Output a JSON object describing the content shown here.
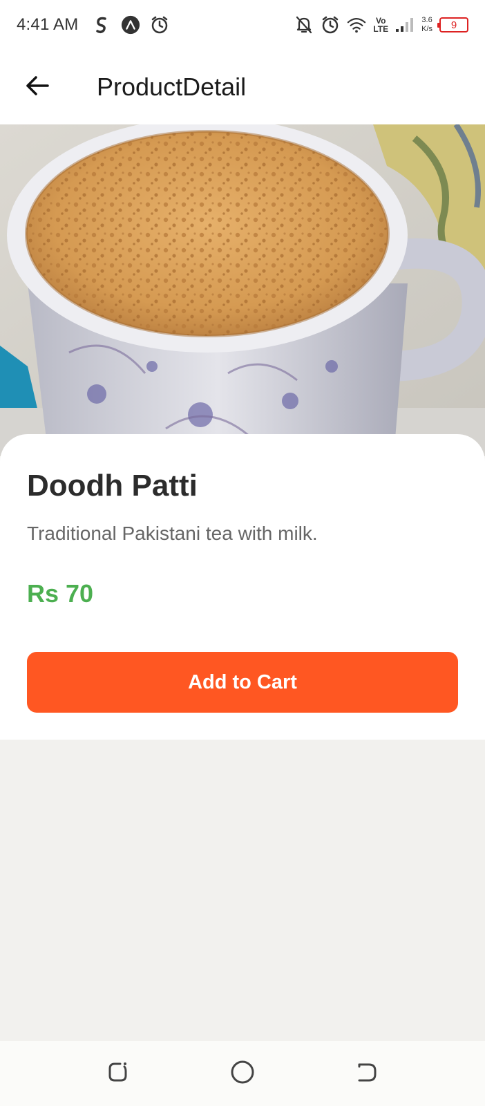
{
  "status_bar": {
    "time": "4:41 AM",
    "network_top": "Vo",
    "network_bottom": "LTE",
    "speed_value": "3.6",
    "speed_unit": "K/s",
    "battery_level": "9"
  },
  "header": {
    "title": "ProductDetail"
  },
  "product": {
    "name": "Doodh Patti",
    "description": "Traditional Pakistani tea with milk.",
    "price": "Rs 70",
    "add_button_label": "Add to Cart"
  },
  "colors": {
    "accent": "#ff5722",
    "price": "#4caf50",
    "battery_low": "#dd2222"
  },
  "icons": {
    "back": "arrow-left-icon",
    "recents": "recents-icon",
    "home": "home-icon",
    "nav_back": "nav-back-icon"
  }
}
